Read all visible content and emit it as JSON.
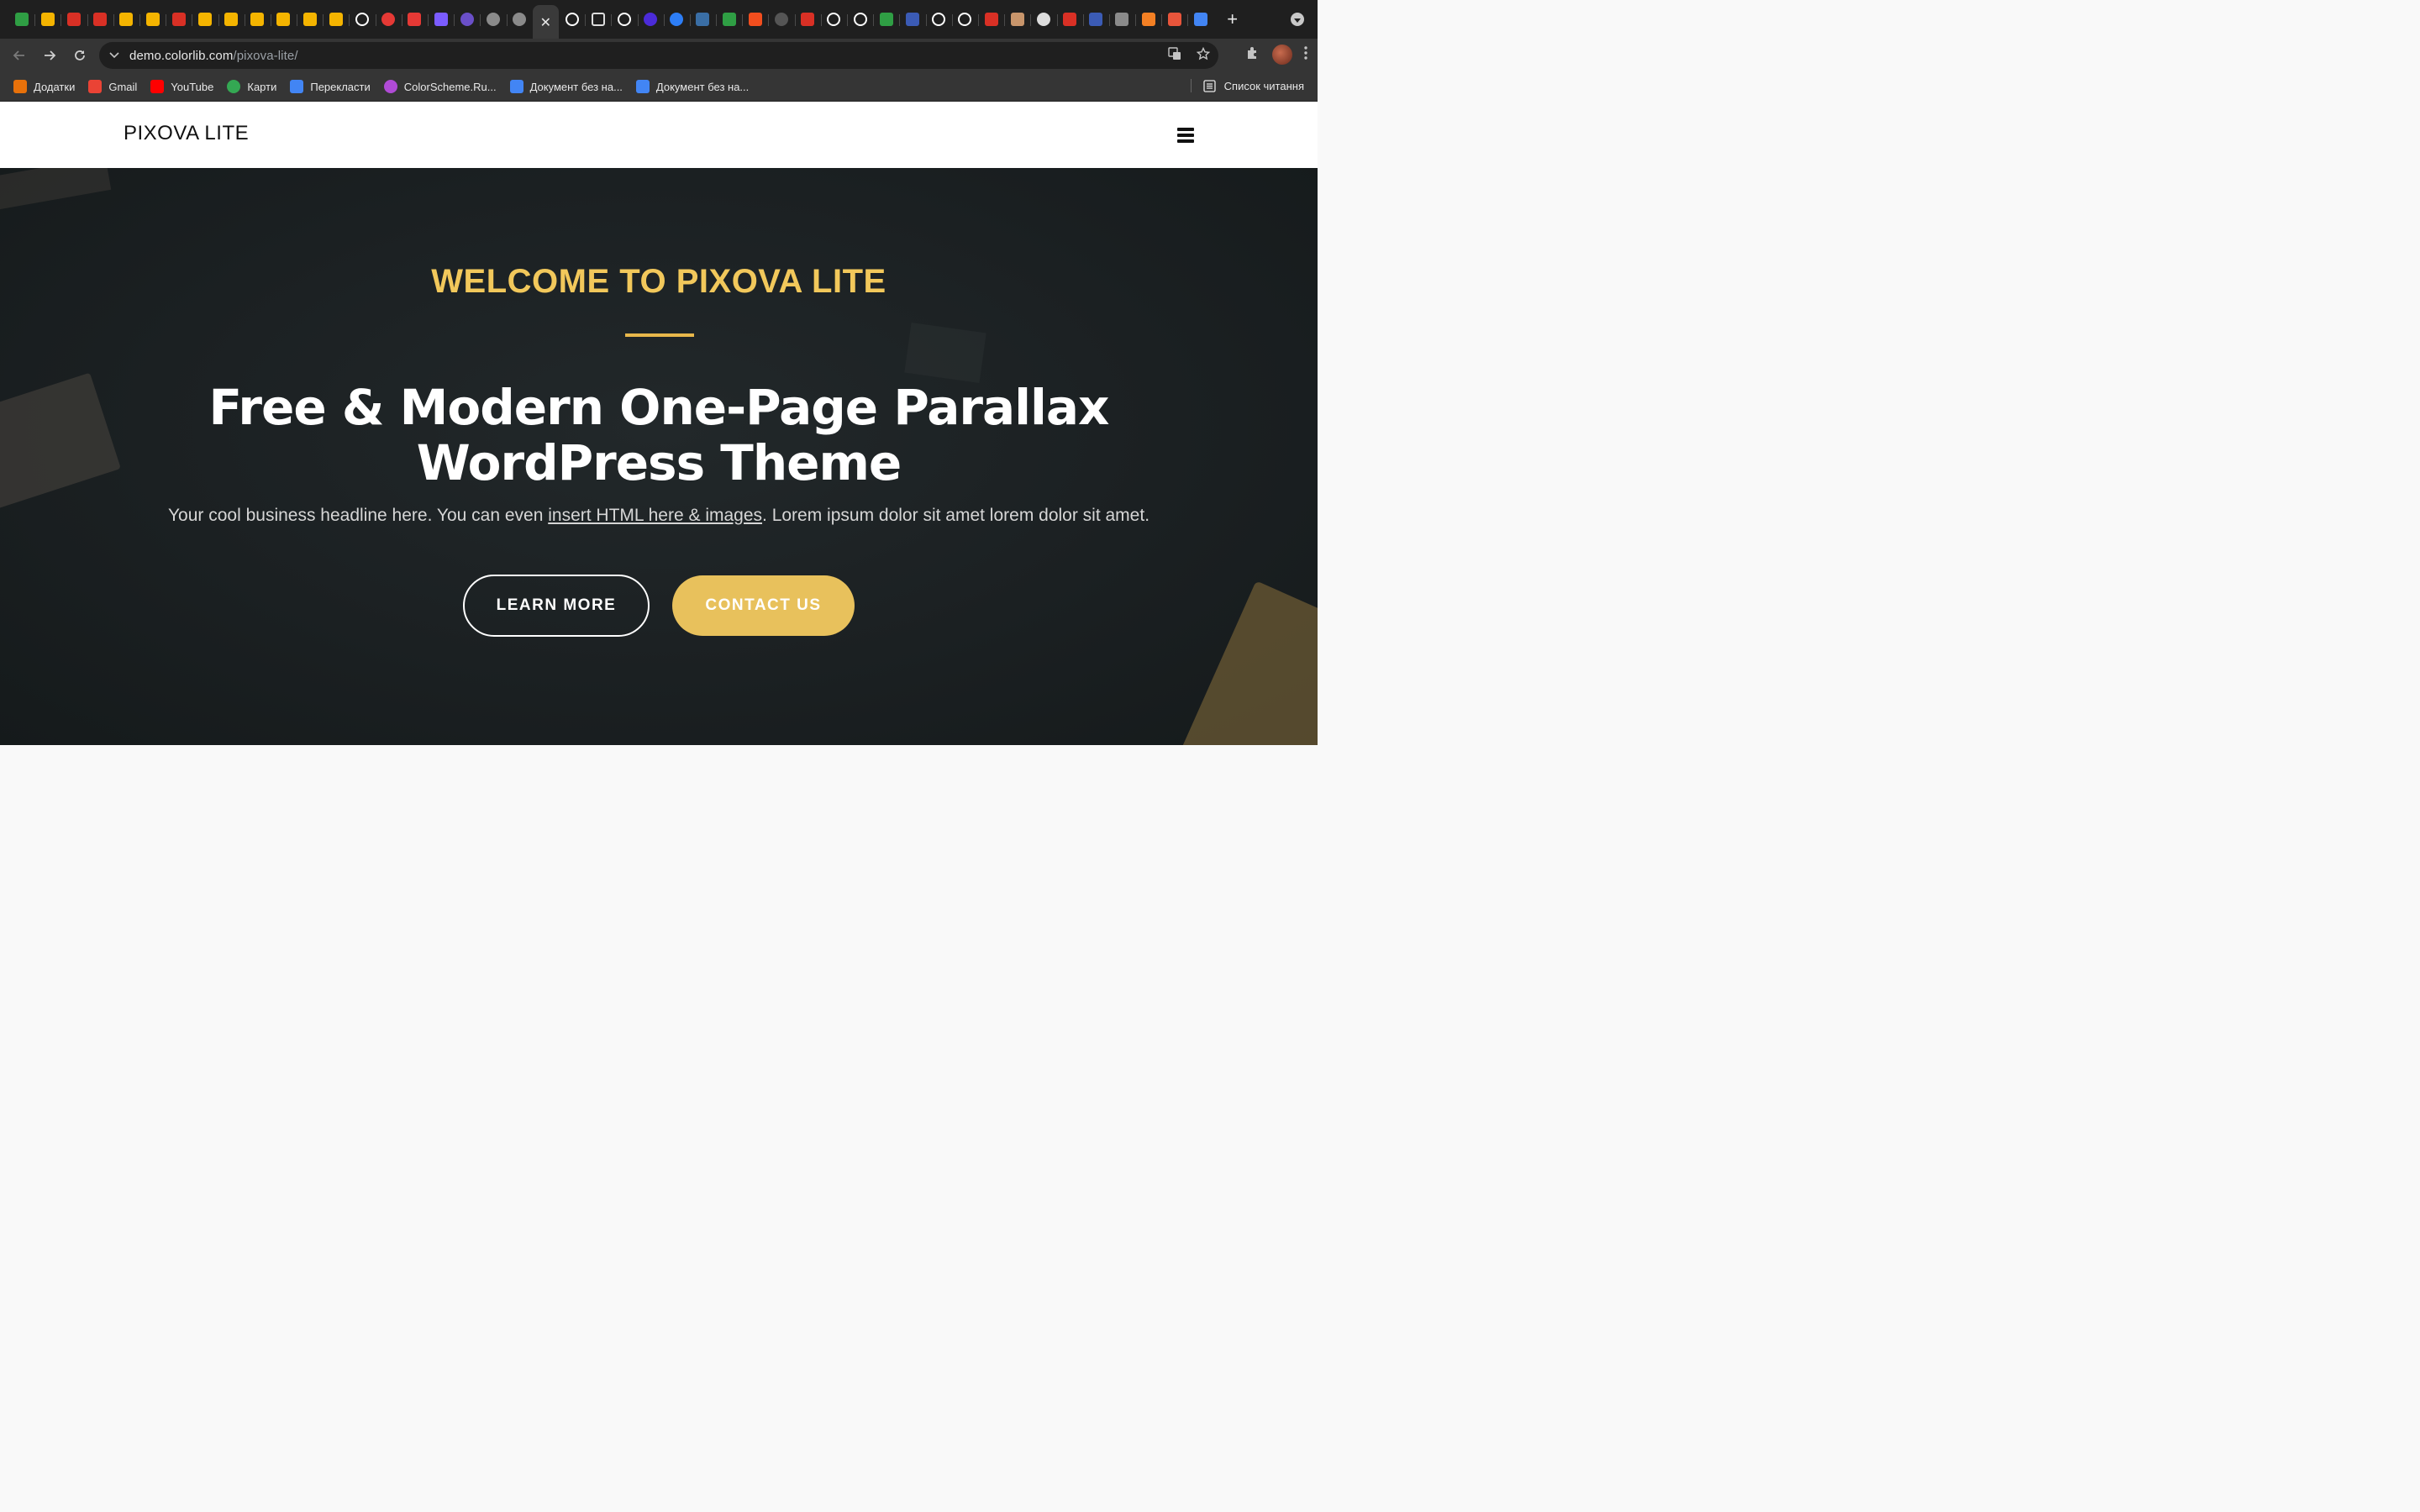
{
  "browser": {
    "tabs": [
      {
        "icon": "google-drive-icon",
        "color": "#2f9e44"
      },
      {
        "icon": "google-slides-icon",
        "color": "#f4b400"
      },
      {
        "icon": "figure-icon",
        "color": "#d93025"
      },
      {
        "icon": "figure-icon",
        "color": "#d93025"
      },
      {
        "icon": "google-slides-icon",
        "color": "#f4b400"
      },
      {
        "icon": "google-slides-icon",
        "color": "#f4b400"
      },
      {
        "icon": "figure-icon",
        "color": "#d93025"
      },
      {
        "icon": "google-slides-icon",
        "color": "#f4b400"
      },
      {
        "icon": "google-slides-icon",
        "color": "#f4b400"
      },
      {
        "icon": "google-slides-icon",
        "color": "#f4b400"
      },
      {
        "icon": "google-slides-icon",
        "color": "#f4b400"
      },
      {
        "icon": "google-slides-icon",
        "color": "#f4b400"
      },
      {
        "icon": "google-slides-icon",
        "color": "#f4b400"
      },
      {
        "icon": "github-icon",
        "color": "#ffffff"
      },
      {
        "icon": "record-icon",
        "color": "#e53935"
      },
      {
        "icon": "snowflake-icon",
        "color": "#e53935"
      },
      {
        "icon": "xb-icon",
        "color": "#7b5cff"
      },
      {
        "icon": "colorlib-icon",
        "color": "#6a4fc8"
      },
      {
        "icon": "globe-icon",
        "color": "#8a8a8a"
      },
      {
        "icon": "globe-icon",
        "color": "#8a8a8a"
      },
      {
        "icon": "close-icon",
        "color": "#e8e8e8",
        "active": true
      },
      {
        "icon": "github-icon",
        "color": "#ffffff"
      },
      {
        "icon": "chat-icon",
        "color": "#dddddd"
      },
      {
        "icon": "google-icon",
        "color": "#ffffff"
      },
      {
        "icon": "circle-icon",
        "color": "#4b2bd8"
      },
      {
        "icon": "target-icon",
        "color": "#2d7ef7"
      },
      {
        "icon": "codepen-icon",
        "color": "#3a6ea5"
      },
      {
        "icon": "google-sheets-add-icon",
        "color": "#2f9e44"
      },
      {
        "icon": "figma-icon",
        "color": "#f24e1e"
      },
      {
        "icon": "t-circle-icon",
        "color": "#555555"
      },
      {
        "icon": "terminal-icon",
        "color": "#d93025"
      },
      {
        "icon": "bubble-icon",
        "color": "#ffffff"
      },
      {
        "icon": "bubble-icon",
        "color": "#ffffff"
      },
      {
        "icon": "google-drive-icon",
        "color": "#2f9e44"
      },
      {
        "icon": "jw-icon",
        "color": "#3b5bb5"
      },
      {
        "icon": "bubble-icon",
        "color": "#ffffff"
      },
      {
        "icon": "bubble-icon",
        "color": "#ffffff"
      },
      {
        "icon": "figure-icon",
        "color": "#d93025"
      },
      {
        "icon": "photo-icon",
        "color": "#c8956b"
      },
      {
        "icon": "spiral-icon",
        "color": "#dddddd"
      },
      {
        "icon": "figure-icon",
        "color": "#d93025"
      },
      {
        "icon": "jw-icon",
        "color": "#3b5bb5"
      },
      {
        "icon": "contact-card-icon",
        "color": "#8a8a8a"
      },
      {
        "icon": "stackoverflow-icon",
        "color": "#f48024"
      },
      {
        "icon": "asterisk-icon",
        "color": "#e8553b"
      },
      {
        "icon": "google-docs-icon",
        "color": "#4285f4"
      }
    ],
    "url_host": "demo.colorlib.com",
    "url_path": "/pixova-lite/",
    "bookmarks": [
      {
        "label": "Додатки",
        "icon": "apps-grid-icon",
        "color": "#e8710a"
      },
      {
        "label": "Gmail",
        "icon": "gmail-icon",
        "color": "#ea4335"
      },
      {
        "label": "YouTube",
        "icon": "youtube-icon",
        "color": "#ff0000"
      },
      {
        "label": "Карти",
        "icon": "maps-pin-icon",
        "color": "#34a853"
      },
      {
        "label": "Перекласти",
        "icon": "translate-icon",
        "color": "#4285f4"
      },
      {
        "label": "ColorScheme.Ru...",
        "icon": "color-wheel-icon",
        "color": "#b04bd6"
      },
      {
        "label": "Документ без на...",
        "icon": "google-docs-icon",
        "color": "#4285f4"
      },
      {
        "label": "Документ без на...",
        "icon": "google-docs-icon",
        "color": "#4285f4"
      }
    ],
    "reading_list": "Список читання"
  },
  "site": {
    "logo": "PIXOVA LITE",
    "hero": {
      "welcome": "WELCOME TO PIXOVA LITE",
      "headline_line1": "Free & Modern One-Page Parallax",
      "headline_line2": "WordPress Theme",
      "tagline_before": "Your cool business headline here. You can even ",
      "tagline_link": "insert HTML here & images",
      "tagline_after": ". Lorem ipsum dolor sit amet lorem dolor sit amet.",
      "learn_more": "LEARN MORE",
      "contact_us": "CONTACT US"
    },
    "colors": {
      "accent": "#f2c85b",
      "button_fill": "#e8c15c",
      "hero_bg": "#1b2022"
    }
  }
}
